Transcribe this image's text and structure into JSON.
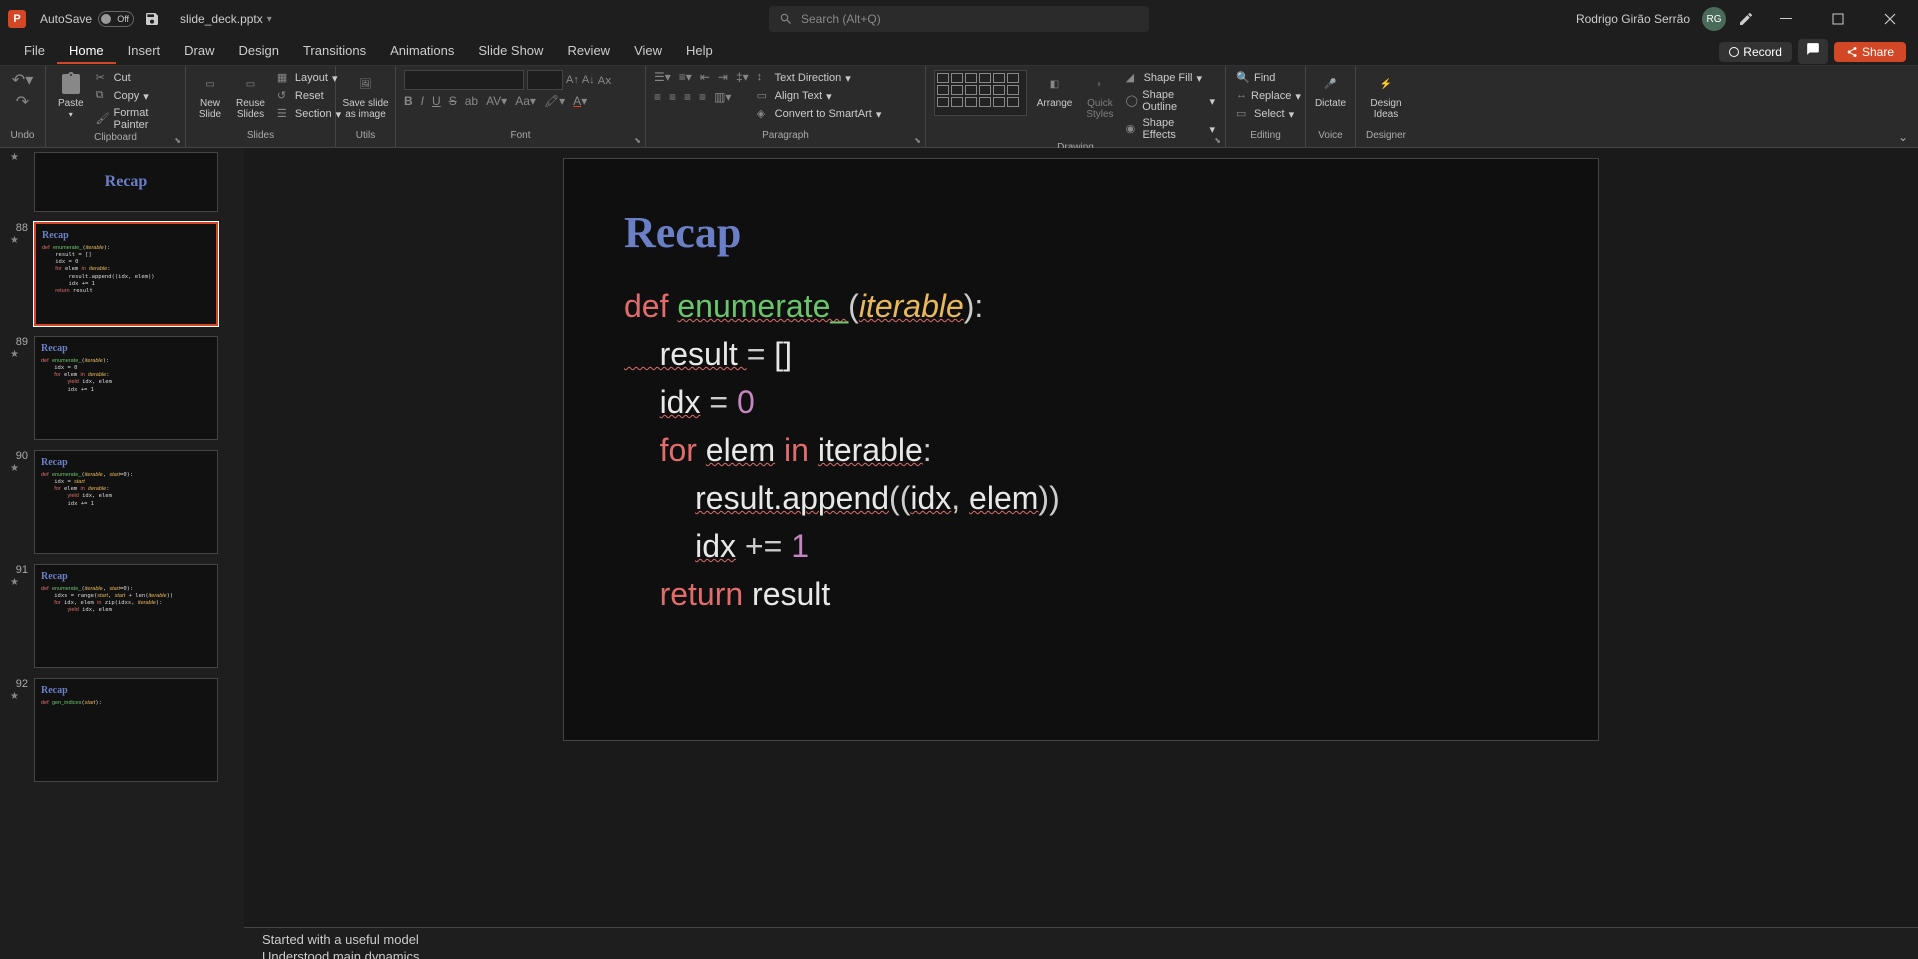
{
  "titlebar": {
    "autosave_label": "AutoSave",
    "autosave_state": "Off",
    "filename": "slide_deck.pptx",
    "search_placeholder": "Search (Alt+Q)",
    "username": "Rodrigo Girão Serrão",
    "avatar_initials": "RG"
  },
  "menu": {
    "items": [
      "File",
      "Home",
      "Insert",
      "Draw",
      "Design",
      "Transitions",
      "Animations",
      "Slide Show",
      "Review",
      "View",
      "Help"
    ],
    "active": "Home",
    "record": "Record",
    "share": "Share"
  },
  "ribbon": {
    "undo": {
      "label": "Undo"
    },
    "clipboard": {
      "label": "Clipboard",
      "paste": "Paste",
      "cut": "Cut",
      "copy": "Copy",
      "format_painter": "Format Painter"
    },
    "slides": {
      "label": "Slides",
      "new_slide": "New\nSlide",
      "reuse_slides": "Reuse\nSlides",
      "layout": "Layout",
      "reset": "Reset",
      "section": "Section"
    },
    "utils": {
      "label": "Utils",
      "save_image": "Save slide\nas image"
    },
    "font": {
      "label": "Font"
    },
    "paragraph": {
      "label": "Paragraph",
      "text_direction": "Text Direction",
      "align_text": "Align Text",
      "smartart": "Convert to SmartArt"
    },
    "drawing": {
      "label": "Drawing",
      "arrange": "Arrange",
      "quick_styles": "Quick\nStyles",
      "shape_fill": "Shape Fill",
      "shape_outline": "Shape Outline",
      "shape_effects": "Shape Effects"
    },
    "editing": {
      "label": "Editing",
      "find": "Find",
      "replace": "Replace",
      "select": "Select"
    },
    "voice": {
      "label": "Voice",
      "dictate": "Dictate"
    },
    "designer": {
      "label": "Designer",
      "design_ideas": "Design\nIdeas"
    }
  },
  "thumbnails": [
    {
      "num": "",
      "title": "Recap",
      "title_only": true
    },
    {
      "num": "88",
      "title": "Recap",
      "selected": true,
      "code": "def enumerate_(iterable):\n    result = []\n    idx = 0\n    for elem in iterable:\n        result.append((idx, elem))\n        idx += 1\n    return result"
    },
    {
      "num": "89",
      "title": "Recap",
      "code": "def enumerate_(iterable):\n    idx = 0\n    for elem in iterable:\n        yield idx, elem\n        idx += 1"
    },
    {
      "num": "90",
      "title": "Recap",
      "code": "def enumerate_(iterable, start=0):\n    idx = start\n    for elem in iterable:\n        yield idx, elem\n        idx += 1"
    },
    {
      "num": "91",
      "title": "Recap",
      "code": "def enumerate_(iterable, start=0):\n    idxs = range(start, start + len(iterable))\n    for idx, elem in zip(idxs, iterable):\n        yield idx, elem"
    },
    {
      "num": "92",
      "title": "Recap",
      "code": "def gen_indices(start):"
    }
  ],
  "slide": {
    "title": "Recap",
    "code_tokens": [
      {
        "t": "def ",
        "c": "kw"
      },
      {
        "t": "enumerate_",
        "c": "fn wavy"
      },
      {
        "t": "(",
        "c": "op"
      },
      {
        "t": "iterable",
        "c": "it wavy"
      },
      {
        "t": "):",
        "c": "op"
      },
      {
        "t": "\n",
        "c": ""
      },
      {
        "t": "    result ",
        "c": "wavy"
      },
      {
        "t": "=",
        "c": "op"
      },
      {
        "t": " []",
        "c": ""
      },
      {
        "t": "\n",
        "c": ""
      },
      {
        "t": "    ",
        "c": ""
      },
      {
        "t": "idx",
        "c": "wavy"
      },
      {
        "t": " ",
        "c": ""
      },
      {
        "t": "=",
        "c": "op"
      },
      {
        "t": " ",
        "c": ""
      },
      {
        "t": "0",
        "c": "num"
      },
      {
        "t": "\n",
        "c": ""
      },
      {
        "t": "    ",
        "c": ""
      },
      {
        "t": "for ",
        "c": "kw"
      },
      {
        "t": "elem",
        "c": "wavy"
      },
      {
        "t": " ",
        "c": ""
      },
      {
        "t": "in ",
        "c": "kw"
      },
      {
        "t": "iterable",
        "c": "wavy"
      },
      {
        "t": ":",
        "c": "op"
      },
      {
        "t": "\n",
        "c": ""
      },
      {
        "t": "        ",
        "c": ""
      },
      {
        "t": "result.append",
        "c": "wavy"
      },
      {
        "t": "((",
        "c": "op"
      },
      {
        "t": "idx",
        "c": "wavy"
      },
      {
        "t": ", ",
        "c": "op"
      },
      {
        "t": "elem",
        "c": "wavy"
      },
      {
        "t": "))",
        "c": "op"
      },
      {
        "t": "\n",
        "c": ""
      },
      {
        "t": "        ",
        "c": ""
      },
      {
        "t": "idx",
        "c": "wavy"
      },
      {
        "t": " ",
        "c": ""
      },
      {
        "t": "+=",
        "c": "op"
      },
      {
        "t": " ",
        "c": ""
      },
      {
        "t": "1",
        "c": "num"
      },
      {
        "t": "\n",
        "c": ""
      },
      {
        "t": "    ",
        "c": ""
      },
      {
        "t": "return ",
        "c": "kw"
      },
      {
        "t": "result",
        "c": ""
      }
    ]
  },
  "notes": {
    "line1": "Started with a useful model",
    "line2": "Understood main dynamics"
  }
}
